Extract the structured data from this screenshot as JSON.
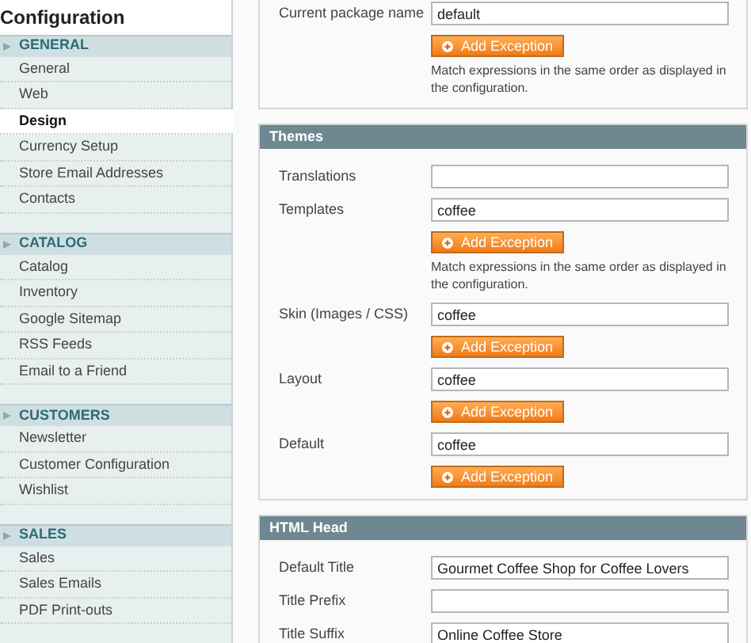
{
  "sidebar": {
    "title": "Configuration",
    "groups": [
      {
        "title": "GENERAL",
        "items": [
          {
            "label": "General",
            "selected": false
          },
          {
            "label": "Web",
            "selected": false
          },
          {
            "label": "Design",
            "selected": true
          },
          {
            "label": "Currency Setup",
            "selected": false
          },
          {
            "label": "Store Email Addresses",
            "selected": false
          },
          {
            "label": "Contacts",
            "selected": false
          }
        ]
      },
      {
        "title": "CATALOG",
        "items": [
          {
            "label": "Catalog",
            "selected": false
          },
          {
            "label": "Inventory",
            "selected": false
          },
          {
            "label": "Google Sitemap",
            "selected": false
          },
          {
            "label": "RSS Feeds",
            "selected": false
          },
          {
            "label": "Email to a Friend",
            "selected": false
          }
        ]
      },
      {
        "title": "CUSTOMERS",
        "items": [
          {
            "label": "Newsletter",
            "selected": false
          },
          {
            "label": "Customer Configuration",
            "selected": false
          },
          {
            "label": "Wishlist",
            "selected": false
          }
        ]
      },
      {
        "title": "SALES",
        "items": [
          {
            "label": "Sales",
            "selected": false
          },
          {
            "label": "Sales Emails",
            "selected": false
          },
          {
            "label": "PDF Print-outs",
            "selected": false
          }
        ]
      }
    ]
  },
  "sections": [
    {
      "rows": [
        {
          "label": "Current package name",
          "value": "default",
          "button": "Add Exception",
          "note": "Match expressions in the same order as displayed in the configuration."
        }
      ]
    },
    {
      "title": "Themes",
      "rows": [
        {
          "label": "Translations"
        },
        {
          "label": "Templates",
          "value": "coffee",
          "button": "Add Exception",
          "note": "Match expressions in the same order as displayed in the configuration."
        },
        {
          "label": "Skin (Images / CSS)",
          "value": "coffee",
          "button": "Add Exception"
        },
        {
          "label": "Layout",
          "value": "coffee",
          "button": "Add Exception"
        },
        {
          "label": "Default",
          "value": "coffee",
          "button": "Add Exception"
        }
      ]
    },
    {
      "title": "HTML Head",
      "rows": [
        {
          "label": "Default Title",
          "value": "Gourmet Coffee Shop for Coffee Lovers"
        },
        {
          "label": "Title Prefix"
        },
        {
          "label": "Title Suffix",
          "value": "Online Coffee Store"
        }
      ]
    }
  ]
}
